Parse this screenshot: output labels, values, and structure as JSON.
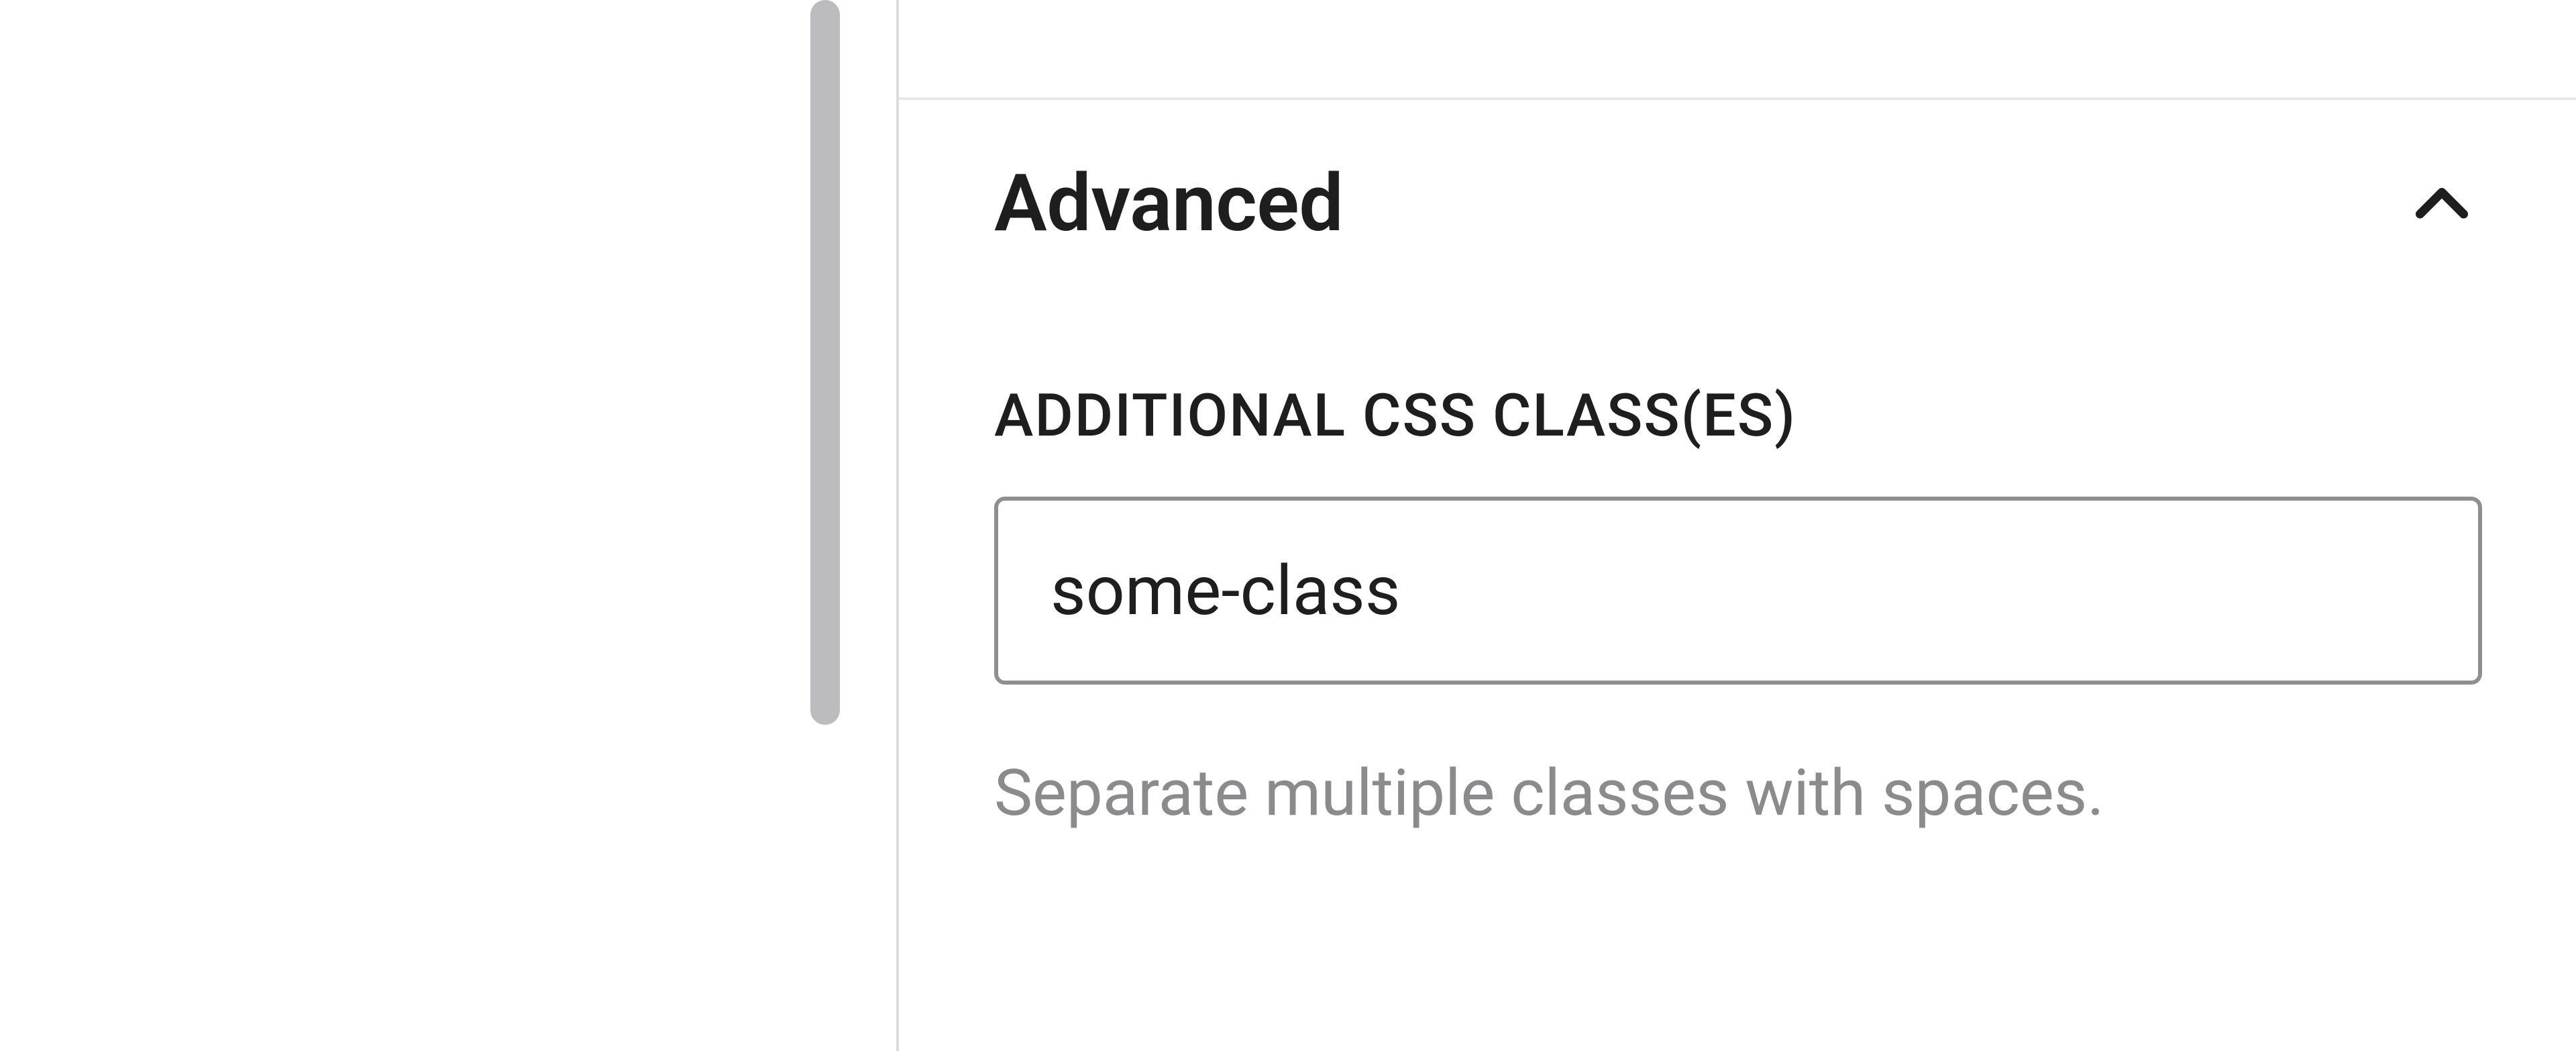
{
  "panel": {
    "title": "Advanced",
    "expanded": true,
    "fields": {
      "additional_css": {
        "label": "ADDITIONAL CSS CLASS(ES)",
        "value": "some-class",
        "help": "Separate multiple classes with spaces."
      }
    }
  },
  "colors": {
    "text": "#1e1e1e",
    "muted": "#8b8b8e",
    "border": "#8f8f91",
    "divider": "#e9e9ea",
    "scroll_thumb": "#bcbcbe"
  }
}
